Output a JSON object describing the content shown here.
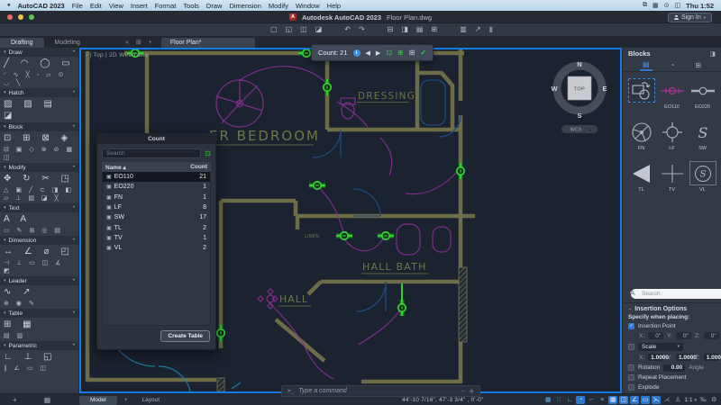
{
  "menu_bar": {
    "apple_logo": "●",
    "app_name": "AutoCAD 2023",
    "items": [
      "File",
      "Edit",
      "View",
      "Insert",
      "Format",
      "Tools",
      "Draw",
      "Dimension",
      "Modify",
      "Window",
      "Help"
    ],
    "status_icons": [
      {
        "g": "⧉",
        "n": "stage-manager-icon"
      },
      {
        "g": "▦",
        "n": "control-center-icon"
      },
      {
        "g": "⊙",
        "n": "screen-mirroring-icon"
      },
      {
        "g": "◫",
        "n": "battery-icon"
      }
    ],
    "clock": "Thu 1:52"
  },
  "title_bar": {
    "logo_letter": "A",
    "title": "Autodesk AutoCAD 2023",
    "document": "Floor Plan.dwg",
    "sign_in": "Sign In"
  },
  "qat_icons": [
    {
      "g": "▢",
      "n": "qnew-icon"
    },
    {
      "g": "◱",
      "n": "open-icon"
    },
    {
      "g": "◫",
      "n": "save-icon"
    },
    {
      "g": "◪",
      "n": "save-as-icon"
    },
    {
      "g": "↶",
      "n": "undo-icon",
      "cls": "sp"
    },
    {
      "g": "↷",
      "n": "redo-icon"
    },
    {
      "g": "⊟",
      "n": "plot-icon",
      "cls": "sp"
    },
    {
      "g": "◨",
      "n": "plot-preview-icon"
    },
    {
      "g": "▤",
      "n": "page-setup-icon"
    },
    {
      "g": "⊞",
      "n": "export-icon"
    },
    {
      "g": "▥",
      "n": "properties-icon",
      "cls": "sp"
    },
    {
      "g": "↗",
      "n": "share-icon"
    },
    {
      "g": "▮",
      "n": "text-cursor",
      "cls": "dim"
    }
  ],
  "workspace_tabs": {
    "drafting": "Drafting",
    "modeling": "Modeling",
    "collapse": "«",
    "grid_icon": "⊞",
    "add": "+"
  },
  "file_tab": "Floor Plan*",
  "left_palette": {
    "sections": [
      {
        "label": "Draw",
        "big": "╱ ◠ ◯ ▭",
        "small": "◜ ∿ ╳ ◦ ▱ ⊙ ◡ ╲"
      },
      {
        "label": "Hatch",
        "big": "▨ ▨ ▤ ◪",
        "small": ""
      },
      {
        "label": "Block",
        "big": "⊡ ⊞ ⊠ ◈",
        "small": "⊟ ▣ ◇ ⊗ ⊘ ▦ ◫"
      },
      {
        "label": "Modify",
        "big": "✥ ↻ ✂ ◳",
        "small": "△ ▣ ╱ ⊂ ◨ ◧ ▱ ⊥ ▨ ◪ ╳"
      },
      {
        "label": "Text",
        "big": "A A",
        "small": "▭ ✎ ⊞ ◎ ▤"
      },
      {
        "label": "Dimension",
        "big": "↔ ∠ ⌀ ◰",
        "small": "⊣ ⊥ ▭ ◫ ∡ ◩"
      },
      {
        "label": "Leader",
        "big": "∿ ↗",
        "small": "⊕ ◉ ✎"
      },
      {
        "label": "Table",
        "big": "⊞ ▦",
        "small": "▤ ▥"
      },
      {
        "label": "Parametric",
        "big": "∟ ⊥ ◱",
        "small": "∥ ∠ ▭ ◫"
      }
    ]
  },
  "viewport": {
    "controls": "-  |  Top  |  2D Wireframe",
    "viewcube": {
      "n": "N",
      "s": "S",
      "e": "E",
      "w": "W",
      "top": "TOP",
      "wcs": "WCS"
    }
  },
  "count_toolbar": {
    "label": "Count: 21"
  },
  "count_palette": {
    "title": "Count",
    "search_placeholder": "Search",
    "columns": {
      "name": "Name ▴",
      "count": "Count"
    },
    "rows": [
      {
        "name": "EO110",
        "count": "21",
        "state": "selected"
      },
      {
        "name": "EO220",
        "count": "1",
        "state": ""
      },
      {
        "name": "FN",
        "count": "1",
        "state": ""
      },
      {
        "name": "LF",
        "count": "8",
        "state": ""
      },
      {
        "name": "SW",
        "count": "17",
        "state": ""
      },
      {
        "name": "TL",
        "count": "2",
        "state": ""
      },
      {
        "name": "TV",
        "count": "1",
        "state": ""
      },
      {
        "name": "VL",
        "count": "2",
        "state": ""
      }
    ],
    "create_table": "Create Table"
  },
  "drawing": {
    "labels": {
      "bedroom": "ER BEDROOM",
      "dressing": "DRESSING",
      "hall_bath": "HALL BATH",
      "hall": "HALL",
      "linen": "LINEN"
    },
    "colors": {
      "wall": "#6c6c46",
      "highlight": "#2ed32e",
      "wiring": "#8e2f96",
      "door": "#1e4a7e",
      "label": "#6f7649",
      "background": "#1b2330",
      "viewport_border": "#1779e3"
    }
  },
  "command_line": {
    "prompt": ">_",
    "placeholder": "Type a command"
  },
  "blocks_panel": {
    "title": "Blocks",
    "items": [
      {
        "label": ""
      },
      {
        "label": "EO110"
      },
      {
        "label": "EO220"
      },
      {
        "label": "FN"
      },
      {
        "label": "LF"
      },
      {
        "label": "SW"
      },
      {
        "label": "TL"
      },
      {
        "label": "TV"
      },
      {
        "label": "VL"
      }
    ],
    "search_placeholder": "Search",
    "insertion_options": {
      "header": "Insertion Options",
      "specify": "Specify when placing:",
      "insertion_point": "Insertion Point",
      "x_label": "X:",
      "y_label": "Y:",
      "z_label": "Z:",
      "x0": "0\"",
      "y0": "0\"",
      "z0": "0\"",
      "scale_label": "Scale",
      "x1": "1.0000",
      "y1": "1.0000",
      "z1": "1.000",
      "rotation": "Rotation",
      "rotation_value": "0.00",
      "angle": "Angle",
      "repeat": "Repeat Placement",
      "explode": "Explode"
    }
  },
  "status_bar": {
    "left_icons": [
      {
        "g": "+",
        "n": "add-palette-icon"
      },
      {
        "g": "▦",
        "n": "palette-settings-icon"
      }
    ],
    "model": "Model",
    "add_layout": "+",
    "layout": "Layout",
    "coordinates": "44'-10 7/16\", 47'-3 3/4\" , 0'-0\"",
    "icons": [
      {
        "g": "▦",
        "n": "snap-mode-icon"
      },
      {
        "g": "∷",
        "n": "grid-display-icon"
      },
      {
        "g": "∟",
        "n": "ortho-mode-icon"
      },
      {
        "g": "◔",
        "n": "isometric-drafting-icon",
        "cls": "on"
      },
      {
        "g": "⌐",
        "n": "object-snap-icon"
      },
      {
        "g": "≡",
        "n": "dynamic-input-icon"
      },
      {
        "g": "▦",
        "n": "object-snap-settings-icon",
        "cls": "on"
      },
      {
        "g": "◫",
        "n": "object-snap-tracking-icon",
        "cls": "on"
      },
      {
        "g": "∠",
        "n": "polar-tracking-icon",
        "cls": "on"
      },
      {
        "g": "▭",
        "n": "lineweight-icon",
        "cls": "on"
      },
      {
        "g": "⋋",
        "n": "selection-cycling-icon",
        "cls": "on"
      },
      {
        "g": "⋌",
        "n": "annotation-monitor-icon",
        "cls": "dim"
      },
      {
        "g": "♙",
        "n": "annotation-visibility-icon",
        "cls": "dim"
      }
    ],
    "scale": "1:1",
    "trail_icons": [
      {
        "g": "‰",
        "n": "annotation-scale-icon",
        "cls": "dim"
      },
      {
        "g": "⚙",
        "n": "customization-gear-icon",
        "cls": "dim"
      }
    ]
  }
}
